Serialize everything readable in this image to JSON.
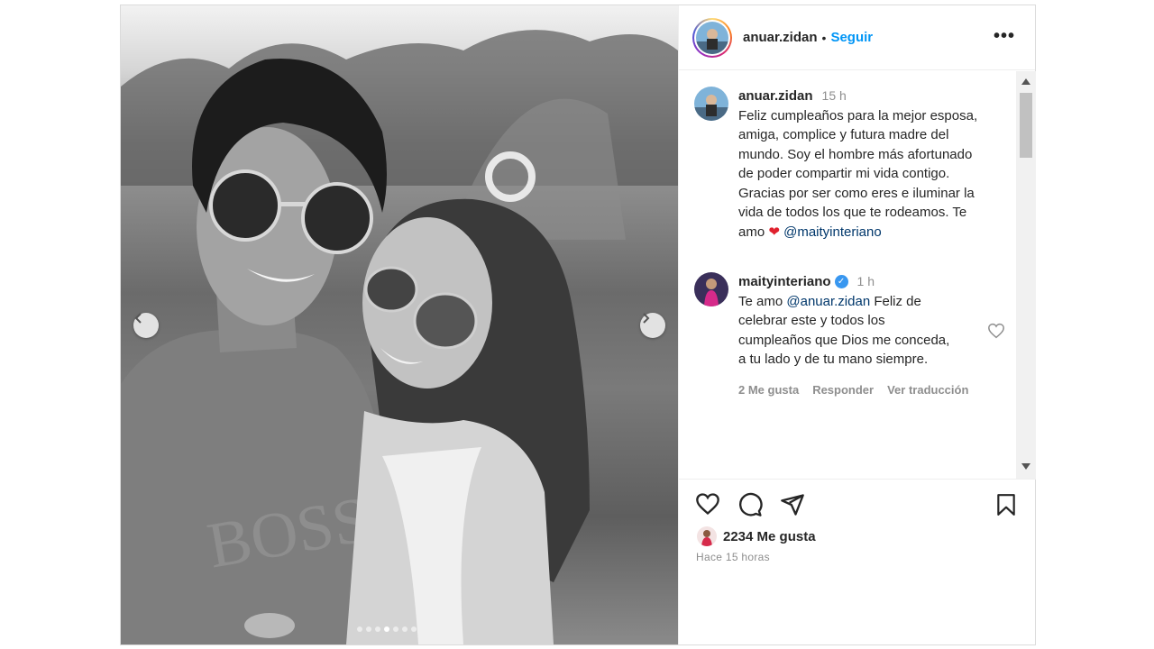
{
  "post": {
    "author": "anuar.zidan",
    "separator": "•",
    "follow_label": "Seguir",
    "more_icon": "more-options-icon",
    "carousel": {
      "slides": 7,
      "active_index": 3
    }
  },
  "comments": [
    {
      "user": "anuar.zidan",
      "time": "15 h",
      "text_lines": [
        "Feliz cumpleaños para la mejor esposa,",
        "amiga, complice y futura madre del",
        "mundo. Soy el hombre más afortunado",
        "de poder compartir mi vida contigo.",
        "Gracias por ser como eres e iluminar la",
        "vida de todos los que te rodeamos. Te"
      ],
      "last_line_prefix": "amo",
      "heart": "❤",
      "mention": "@maityinteriano"
    },
    {
      "user": "maityinteriano",
      "verified": "✓",
      "time": "1 h",
      "first_prefix": "Te amo",
      "mention": "@anuar.zidan",
      "first_suffix": "Feliz de",
      "text_lines": [
        "celebrar este y todos los",
        "cumpleaños que Dios me conceda,",
        "a tu lado y de tu mano siempre."
      ],
      "likes": "2 Me gusta",
      "reply": "Responder",
      "translate": "Ver traducción"
    }
  ],
  "actions": {
    "like_count": "2234 Me gusta",
    "timestamp": "Hace 15 horas"
  },
  "colors": {
    "link_blue": "#0095f6",
    "mention": "#00376b",
    "heart": "#e0212e",
    "muted": "#8e8e8e"
  }
}
